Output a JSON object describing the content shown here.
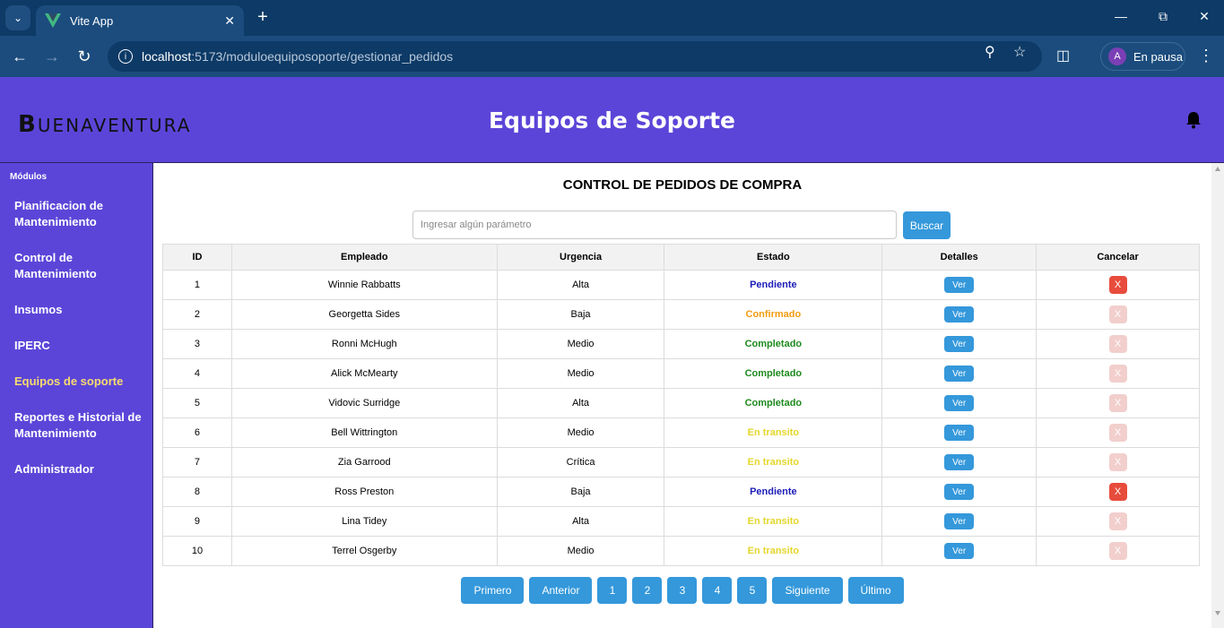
{
  "browser": {
    "tab_title": "Vite App",
    "url_host": "localhost",
    "url_path": ":5173/moduloequiposoporte/gestionar_pedidos",
    "profile_initial": "A",
    "profile_label": "En pausa"
  },
  "header": {
    "logo_initial": "B",
    "logo_rest": "UENAVENTURA",
    "title": "Equipos de Soporte"
  },
  "sidebar": {
    "title": "Módulos",
    "items": [
      {
        "label": "Planificacion de Mantenimiento",
        "active": false
      },
      {
        "label": "Control de Mantenimiento",
        "active": false
      },
      {
        "label": "Insumos",
        "active": false
      },
      {
        "label": "IPERC",
        "active": false
      },
      {
        "label": "Equipos de soporte",
        "active": true
      },
      {
        "label": "Reportes e Historial de Mantenimiento",
        "active": false
      },
      {
        "label": "Administrador",
        "active": false
      }
    ]
  },
  "main": {
    "title": "CONTROL DE PEDIDOS DE COMPRA",
    "search_placeholder": "Ingresar algún parámetro",
    "search_button": "Buscar",
    "columns": [
      "ID",
      "Empleado",
      "Urgencia",
      "Estado",
      "Detalles",
      "Cancelar"
    ],
    "rows": [
      {
        "id": "1",
        "empleado": "Winnie Rabbatts",
        "urgencia": "Alta",
        "estado": "Pendiente",
        "estado_class": "pendiente",
        "ver": "Ver",
        "cancel": "X",
        "cancel_enabled": true
      },
      {
        "id": "2",
        "empleado": "Georgetta Sides",
        "urgencia": "Baja",
        "estado": "Confirmado",
        "estado_class": "confirmado",
        "ver": "Ver",
        "cancel": "X",
        "cancel_enabled": false
      },
      {
        "id": "3",
        "empleado": "Ronni McHugh",
        "urgencia": "Medio",
        "estado": "Completado",
        "estado_class": "completado",
        "ver": "Ver",
        "cancel": "X",
        "cancel_enabled": false
      },
      {
        "id": "4",
        "empleado": "Alick McMearty",
        "urgencia": "Medio",
        "estado": "Completado",
        "estado_class": "completado",
        "ver": "Ver",
        "cancel": "X",
        "cancel_enabled": false
      },
      {
        "id": "5",
        "empleado": "Vidovic Surridge",
        "urgencia": "Alta",
        "estado": "Completado",
        "estado_class": "completado",
        "ver": "Ver",
        "cancel": "X",
        "cancel_enabled": false
      },
      {
        "id": "6",
        "empleado": "Bell Wittrington",
        "urgencia": "Medio",
        "estado": "En transito",
        "estado_class": "transito",
        "ver": "Ver",
        "cancel": "X",
        "cancel_enabled": false
      },
      {
        "id": "7",
        "empleado": "Zia Garrood",
        "urgencia": "Crítica",
        "estado": "En transito",
        "estado_class": "transito",
        "ver": "Ver",
        "cancel": "X",
        "cancel_enabled": false
      },
      {
        "id": "8",
        "empleado": "Ross Preston",
        "urgencia": "Baja",
        "estado": "Pendiente",
        "estado_class": "pendiente",
        "ver": "Ver",
        "cancel": "X",
        "cancel_enabled": true
      },
      {
        "id": "9",
        "empleado": "Lina Tidey",
        "urgencia": "Alta",
        "estado": "En transito",
        "estado_class": "transito",
        "ver": "Ver",
        "cancel": "X",
        "cancel_enabled": false
      },
      {
        "id": "10",
        "empleado": "Terrel Osgerby",
        "urgencia": "Medio",
        "estado": "En transito",
        "estado_class": "transito",
        "ver": "Ver",
        "cancel": "X",
        "cancel_enabled": false
      }
    ],
    "pagination": {
      "first": "Primero",
      "prev": "Anterior",
      "pages": [
        "1",
        "2",
        "3",
        "4",
        "5"
      ],
      "next": "Siguiente",
      "last": "Último"
    }
  },
  "colors": {
    "brand_purple": "#5b45d8",
    "button_blue": "#3498db",
    "cancel_red": "#e74c3c",
    "active_sidebar": "#f7dc6f"
  }
}
